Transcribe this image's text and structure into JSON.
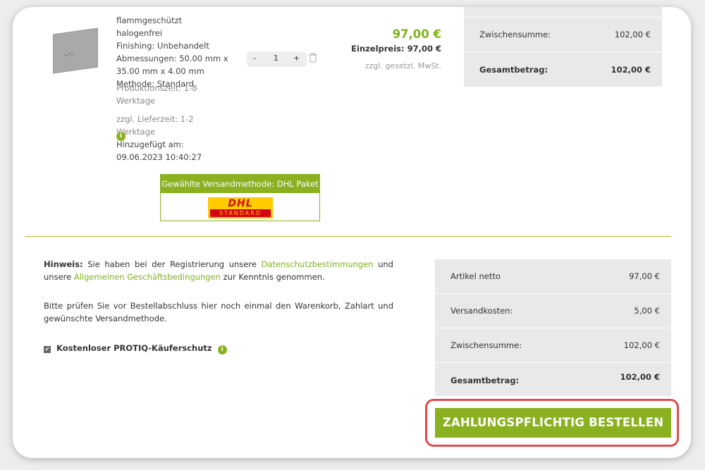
{
  "product": {
    "icon": "product-thumbnail",
    "lines": [
      "flammgeschützt halogenfrei",
      "Finishing: Unbehandelt",
      "Abmessungen: 50.00 mm x",
      "35.00 mm x 4.00 mm",
      "Methode: Standard"
    ],
    "production_time": "Produktionszeit: 1-8 Werktage",
    "delivery_time": "zzgl. Lieferzeit: 1-2 Werktage",
    "added_label": "Hinzugefügt am: 09.06.2023 10:40:27",
    "thumb_mark": "〰"
  },
  "quantity": {
    "minus": "-",
    "value": "1",
    "plus": "+"
  },
  "price": {
    "total": "97,00 €",
    "unit": "Einzelpreis: 97,00 €",
    "tax_note": "zzgl. gesetzl. MwSt."
  },
  "summary_top": {
    "subtotal_label": "Zwischensumme:",
    "subtotal_value": "102,00 €",
    "total_label": "Gesamtbetrag:",
    "total_value": "102,00 €"
  },
  "shipping": {
    "header": "Gewählte Versandmethode: DHL Paket",
    "logo_text": "DHL",
    "logo_sub": "STANDARD"
  },
  "note": {
    "hint_label": "Hinweis:",
    "hint_text_1": "Sie haben bei der Registrierung unsere",
    "privacy_link": "Datenschutzbestimmungen",
    "hint_text_2": "und unsere",
    "terms_link": "Allgemeinen Geschäftsbedingungen",
    "hint_text_3": "zur Kenntnis genommen.",
    "check_text": "Bitte prüfen Sie vor Bestellabschluss hier noch einmal den Warenkorb, Zahlart und gewünschte Versandmethode.",
    "protection_label": "Kostenloser PROTIQ-Käuferschutz",
    "checkbox_mark": "✔",
    "info_mark": "i"
  },
  "summary_bottom": {
    "rows": [
      {
        "label": "Artikel netto",
        "value": "97,00 €"
      },
      {
        "label": "Versandkosten:",
        "value": "5,00 €"
      },
      {
        "label": "Zwischensumme:",
        "value": "102,00 €"
      },
      {
        "label": "Gesamtbetrag:",
        "value": "102,00 €"
      }
    ]
  },
  "order_button": "ZAHLUNGSPFLICHTIG BESTELLEN",
  "colors": {
    "accent": "#8ab11f",
    "highlight": "#e24a4a",
    "panel": "#e9e9e9"
  }
}
